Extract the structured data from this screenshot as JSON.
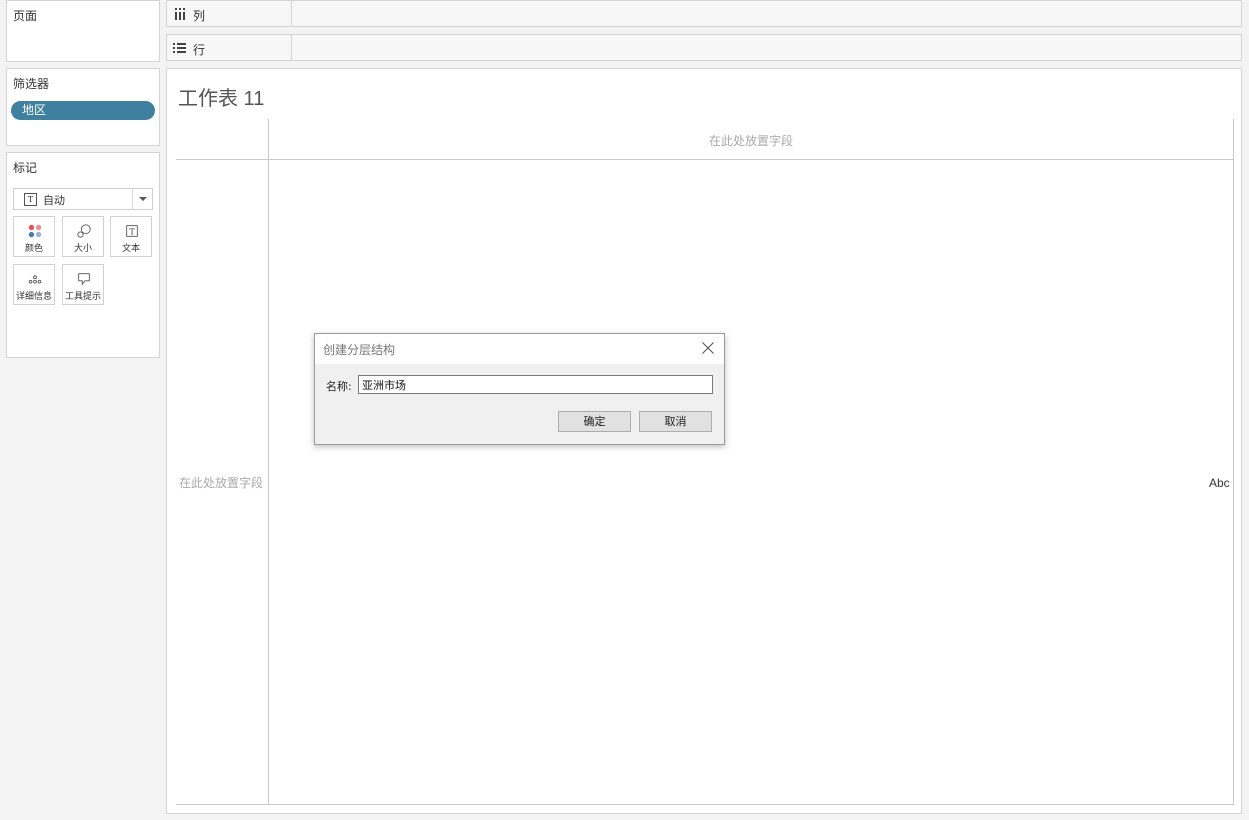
{
  "left_panel": {
    "pages": {
      "title": "页面"
    },
    "filters": {
      "title": "筛选器",
      "pill": "地区"
    },
    "marks": {
      "title": "标记",
      "type_selected": "自动",
      "buttons": [
        {
          "label": "颜色",
          "icon": "color-dots-icon"
        },
        {
          "label": "大小",
          "icon": "size-icon"
        },
        {
          "label": "文本",
          "icon": "text-icon"
        },
        {
          "label": "详细信息",
          "icon": "detail-dots-icon"
        },
        {
          "label": "工具提示",
          "icon": "tooltip-icon"
        }
      ]
    }
  },
  "shelves": {
    "columns": {
      "label": "列",
      "icon": "columns-icon"
    },
    "rows": {
      "label": "行",
      "icon": "rows-icon"
    }
  },
  "view": {
    "sheet_title": "工作表 11",
    "col_drop_hint": "在此处放置字段",
    "row_drop_hint": "在此处放置字段",
    "placeholder_mark": "Abc"
  },
  "dialog": {
    "title": "创建分层结构",
    "name_label": "名称:",
    "name_value": "亚洲市场",
    "ok_label": "确定",
    "cancel_label": "取消"
  },
  "colors": {
    "filter_pill": "#3f7fa0",
    "color_dots": [
      "#e15759",
      "#f28e8c",
      "#4e79a7",
      "#9bb3cf"
    ]
  }
}
